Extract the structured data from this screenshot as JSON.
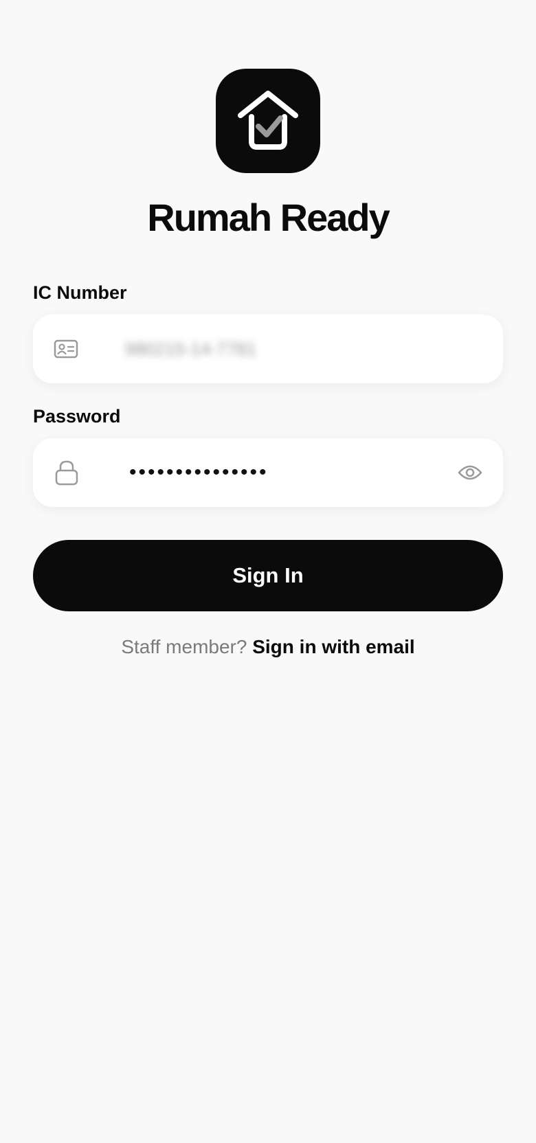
{
  "app": {
    "title": "Rumah Ready",
    "logo_icon": "house-check-icon",
    "background_color": "#f9f9f9",
    "accent_color": "#0b0b0b"
  },
  "form": {
    "ic_number": {
      "label": "IC Number",
      "value": "980215-14-7781",
      "icon": "id-card-icon"
    },
    "password": {
      "label": "Password",
      "value": "•••••••••••••••",
      "icon": "lock-icon",
      "toggle_icon": "eye-icon"
    },
    "sign_in_label": "Sign In"
  },
  "staff": {
    "prompt": "Staff member?",
    "link_label": "Sign in with email"
  }
}
